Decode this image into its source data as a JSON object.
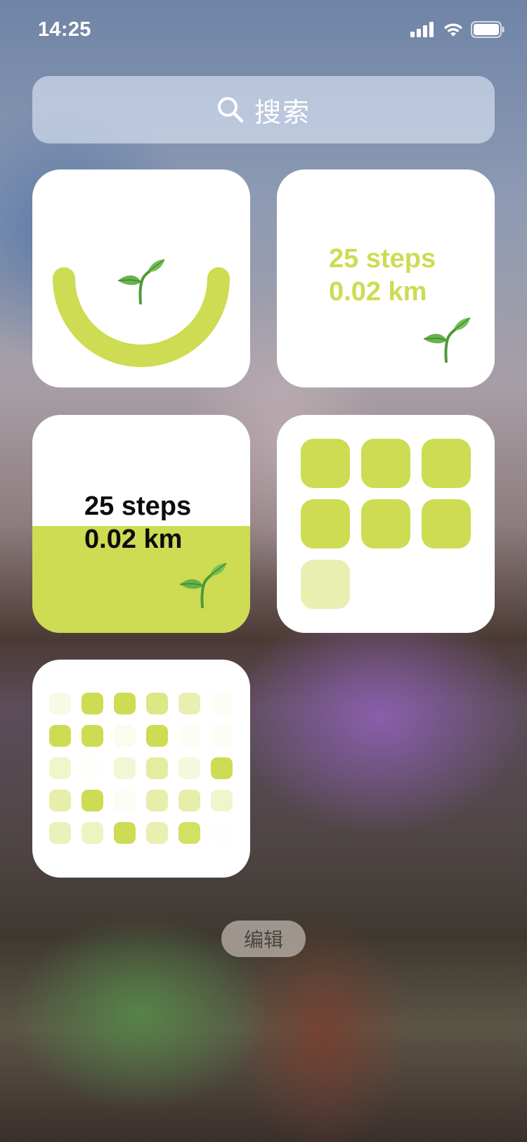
{
  "status_bar": {
    "time": "14:25",
    "signal_icon": "cellular-signal-icon",
    "wifi_icon": "wifi-icon",
    "battery_icon": "battery-icon"
  },
  "search": {
    "icon": "search-icon",
    "label": "搜索"
  },
  "widgets": {
    "progress_arc": {
      "icon": "sprout-icon",
      "accent_color": "#cddc52"
    },
    "stats_light": {
      "steps": "25 steps",
      "distance": "0.02 km",
      "icon": "sprout-icon",
      "text_color": "#cddc52"
    },
    "stats_filled": {
      "steps": "25 steps",
      "distance": "0.02 km",
      "icon": "sprout-icon",
      "fill_color": "#cddc52",
      "fill_level": 0.49
    },
    "tile_grid": {
      "levels": [
        1,
        1,
        1,
        1,
        1,
        1,
        0.45
      ]
    },
    "dot_grid": {
      "rows": [
        [
          0.15,
          1,
          1,
          0.7,
          0.45,
          0.05
        ],
        [
          1,
          1,
          0.1,
          1,
          0.05,
          0.05
        ],
        [
          0.3,
          0.03,
          0.25,
          0.55,
          0.2,
          1
        ],
        [
          0.5,
          1,
          0.05,
          0.5,
          0.5,
          0.3
        ],
        [
          0.4,
          0.35,
          1,
          0.45,
          0.9,
          0.02
        ]
      ]
    }
  },
  "edit_button": {
    "label": "编辑"
  },
  "colors": {
    "accent": "#cddc52",
    "tile_empty": "#ffffff"
  }
}
